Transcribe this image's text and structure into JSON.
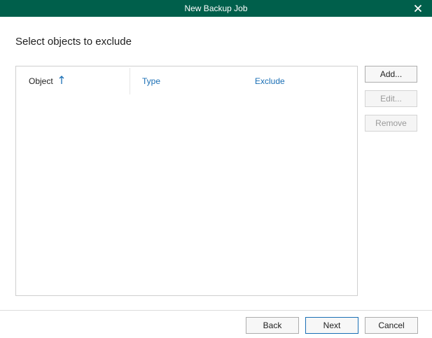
{
  "window": {
    "title": "New Backup Job"
  },
  "page": {
    "heading": "Select objects to exclude"
  },
  "table": {
    "columns": [
      {
        "label": "Object",
        "sort": "ascending"
      },
      {
        "label": "Type"
      },
      {
        "label": "Exclude"
      }
    ],
    "rows": []
  },
  "side_buttons": {
    "add": "Add...",
    "edit": "Edit...",
    "remove": "Remove"
  },
  "footer": {
    "back": "Back",
    "next": "Next",
    "cancel": "Cancel"
  },
  "colors": {
    "titlebar": "#005f4b",
    "link": "#1a6fb5"
  }
}
